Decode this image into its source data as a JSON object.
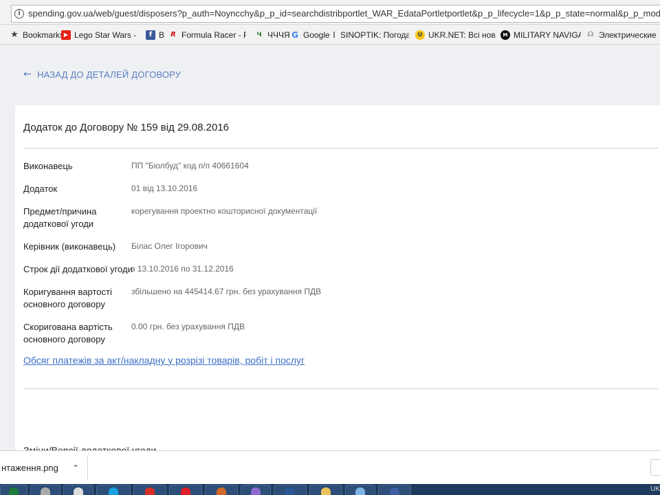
{
  "browser": {
    "url": "spending.gov.ua/web/guest/disposers?p_auth=Noyncchy&p_p_id=searchdistribportlet_WAR_EdataPortletportlet&p_p_lifecycle=1&p_p_state=normal&p_p_mode=view&p_p_col_id="
  },
  "bookmarks": [
    {
      "label": "Bookmarks",
      "icon": "star-icon",
      "color": "#444444"
    },
    {
      "label": "Lego Star Wars - Batt",
      "icon": "youtube-icon",
      "color": "#e62117"
    },
    {
      "label": "B",
      "icon": "facebook-icon",
      "color": "#3b5998"
    },
    {
      "label": "Formula Racer - Free",
      "icon": "racer-icon",
      "color": "#cc1111"
    },
    {
      "label": "ЧЧЧЯ",
      "icon": "chchchya-icon",
      "color": "#2e7d32"
    },
    {
      "label": "Google",
      "icon": "google-icon",
      "color": "#4285f4"
    },
    {
      "label": "SINOPTIK: Погода на",
      "icon": "thermometer-icon",
      "color": "#777777"
    },
    {
      "label": "UKR.NET: Всі новини",
      "icon": "ukrnet-icon",
      "color": "#f5c518"
    },
    {
      "label": "MILITARY NAVIGATO",
      "icon": "military-icon",
      "color": "#111111"
    },
    {
      "label": "Электрические",
      "icon": "electric-icon",
      "color": "#666666"
    }
  ],
  "page": {
    "back_label": "НАЗАД ДО ДЕТАЛЕЙ ДОГОВОРУ",
    "title": "Додаток до Договору № 159 від 29.08.2016",
    "rows": [
      {
        "label": "Виконавець",
        "value": "ПП \"Біолбуд\" код п/п 40661604"
      },
      {
        "label": "Додаток",
        "value": "01 від 13.10.2016"
      },
      {
        "label": "Предмет/причина додаткової угоди",
        "value": "корегування проектно кошторисної документації"
      },
      {
        "label": "Керівник (виконавець)",
        "value": "Білас Олег Ігорович"
      },
      {
        "label": "Строк дії додаткової угоди",
        "value": "з 13.10.2016 по 31.12.2016"
      },
      {
        "label": "Коригування вартості основного договору",
        "value": "збільшено на 445414.67 грн. без урахування ПДВ"
      },
      {
        "label": "Скоригована вартість основного договору",
        "value": "0.00 грн. без урахування ПДВ"
      }
    ],
    "payments_link": "Обсяг платежів за акт/накладну у розрізі товарів, робіт і послуг",
    "cut_heading": "Зміни/Версії додаткової угоди"
  },
  "downloads": {
    "file": "нтаження.png"
  },
  "taskbar": {
    "tray_lang": "UK"
  }
}
